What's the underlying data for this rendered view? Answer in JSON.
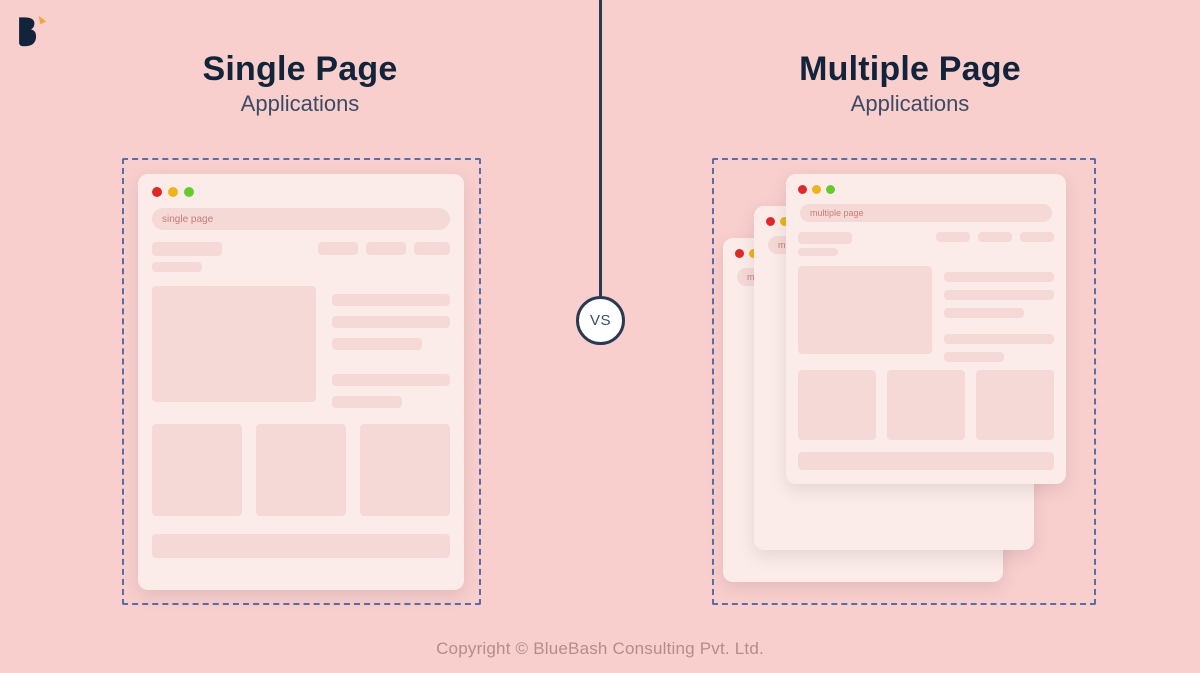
{
  "left": {
    "title": "Single Page",
    "subtitle": "Applications",
    "addressbar": "single page"
  },
  "right": {
    "title": "Multiple Page",
    "subtitle": "Applications",
    "addressbar_1": "multiple page",
    "addressbar_2": "multi",
    "addressbar_3": "mult"
  },
  "center": {
    "vs_label": "VS"
  },
  "footer": {
    "copyright": "Copyright © BlueBash Consulting Pvt. Ltd."
  },
  "colors": {
    "background": "#f9cfce",
    "window": "#fcece9",
    "wire": "#f5d9d6",
    "dash_border": "#5a6da8",
    "text_dark": "#13243a",
    "traffic_red": "#df2828",
    "traffic_yellow": "#eeb31e",
    "traffic_green": "#68c92e"
  }
}
